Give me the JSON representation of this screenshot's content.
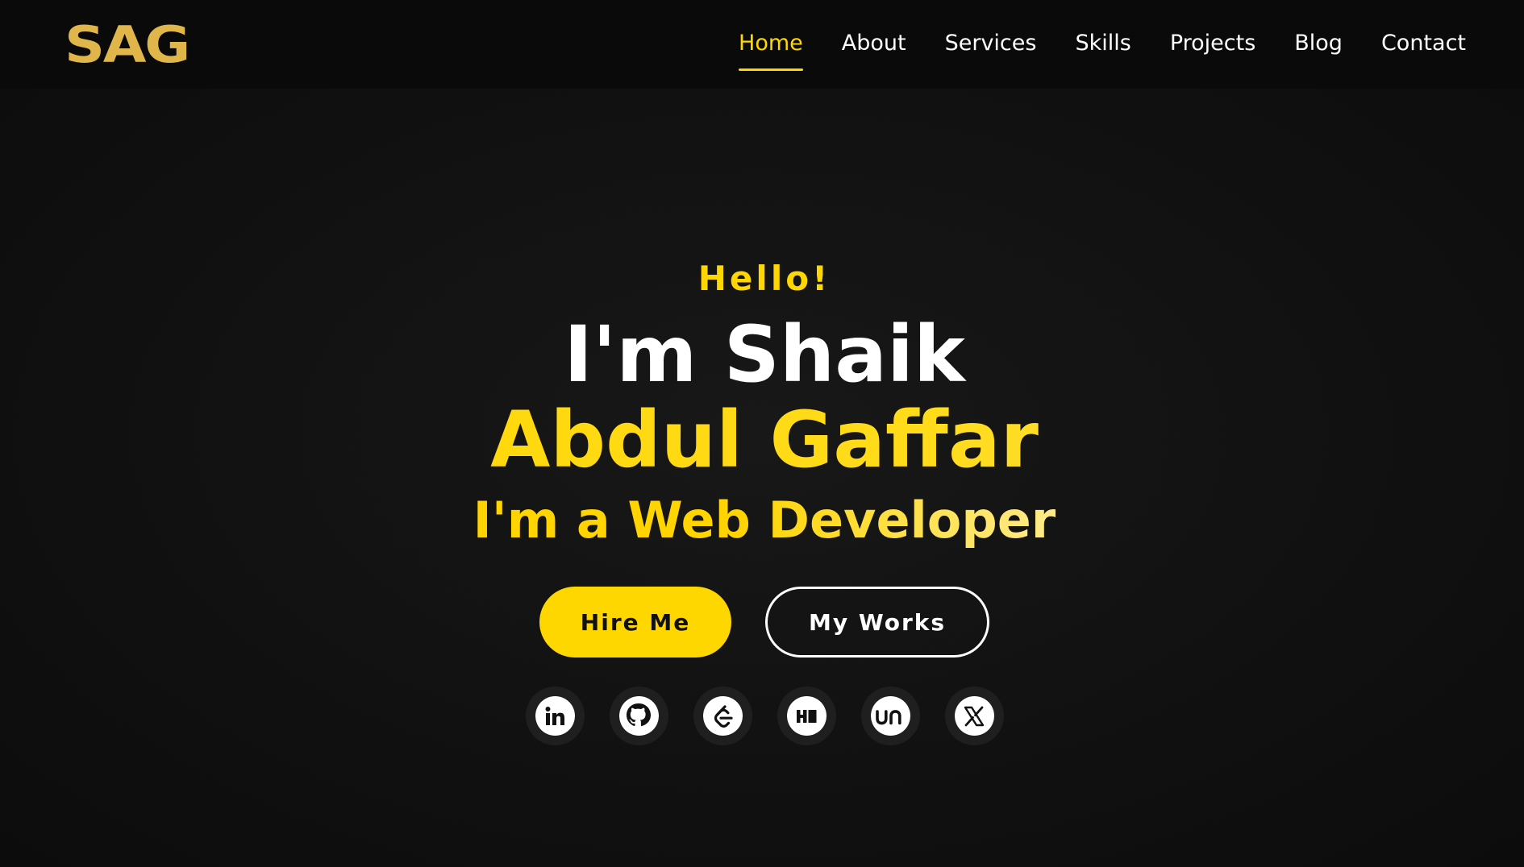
{
  "brand": {
    "logo_text": "SAG",
    "logo_color": "#e0b54a"
  },
  "nav": {
    "items": [
      {
        "label": "Home",
        "active": true
      },
      {
        "label": "About"
      },
      {
        "label": "Services"
      },
      {
        "label": "Skills"
      },
      {
        "label": "Projects"
      },
      {
        "label": "Blog"
      },
      {
        "label": "Contact"
      }
    ]
  },
  "hero": {
    "greeting": "Hello!",
    "name_line1": "I'm Shaik",
    "name_line2": "Abdul Gaffar",
    "role": "I'm a Web Developer",
    "primary_button": "Hire Me",
    "secondary_button": "My Works"
  },
  "socials": [
    {
      "icon": "linkedin-icon"
    },
    {
      "icon": "github-icon"
    },
    {
      "icon": "leetcode-icon"
    },
    {
      "icon": "hashnode-icon"
    },
    {
      "icon": "unstop-icon"
    },
    {
      "icon": "x-twitter-icon"
    }
  ],
  "colors": {
    "accent": "#ffd700",
    "background": "#111111",
    "text": "#ffffff"
  }
}
